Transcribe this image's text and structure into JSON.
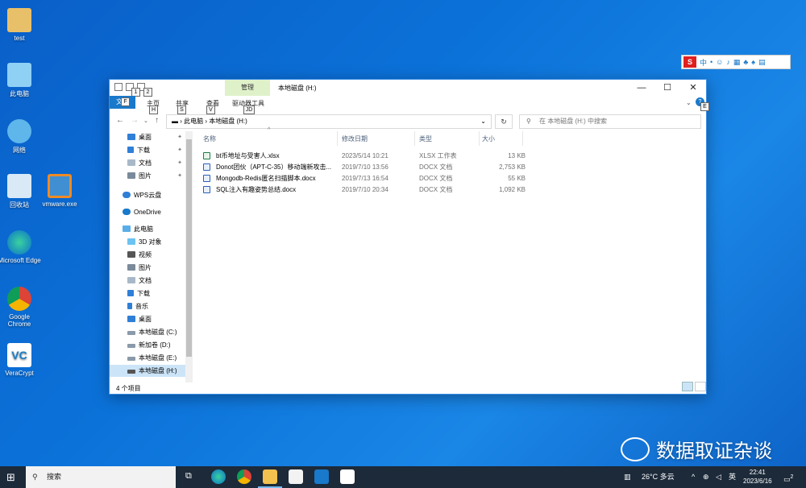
{
  "desktop": {
    "icons": [
      {
        "label": "test"
      },
      {
        "label": "此电脑"
      },
      {
        "label": "网络"
      },
      {
        "label": "回收站"
      },
      {
        "label": "vmware.exe"
      },
      {
        "label": "Microsoft Edge"
      },
      {
        "label": "Google Chrome"
      },
      {
        "label": "VeraCrypt"
      }
    ]
  },
  "window": {
    "title": "本地磁盘 (H:)",
    "manage_tab": "管理",
    "ribbon_tabs": {
      "file": "文件",
      "home": "主页",
      "share": "共享",
      "view": "查看",
      "drive_tools": "驱动器工具"
    },
    "keytips": {
      "file": "F",
      "one": "1",
      "two": "2",
      "home": "H",
      "share": "S",
      "view": "V",
      "drive": "JD",
      "e": "E"
    },
    "buttons": {
      "minimize": "—",
      "maximize": "☐",
      "close": "✕"
    },
    "address": {
      "crumb1": "此电脑",
      "crumb2": "本地磁盘 (H:)"
    },
    "search": {
      "placeholder": "在 本地磁盘 (H:) 中搜索"
    },
    "nav_items": [
      {
        "label": "桌面",
        "pinned": true
      },
      {
        "label": "下载",
        "pinned": true
      },
      {
        "label": "文档",
        "pinned": true
      },
      {
        "label": "图片",
        "pinned": true
      },
      {
        "label": "WPS云盘"
      },
      {
        "label": "OneDrive"
      },
      {
        "label": "此电脑"
      },
      {
        "label": "3D 对象"
      },
      {
        "label": "视频"
      },
      {
        "label": "图片"
      },
      {
        "label": "文档"
      },
      {
        "label": "下载"
      },
      {
        "label": "音乐"
      },
      {
        "label": "桌面"
      },
      {
        "label": "本地磁盘 (C:)"
      },
      {
        "label": "新加卷 (D:)"
      },
      {
        "label": "本地磁盘 (E:)"
      },
      {
        "label": "本地磁盘 (H:)",
        "selected": true
      }
    ],
    "columns": {
      "name": "名称",
      "date": "修改日期",
      "type": "类型",
      "size": "大小"
    },
    "files": [
      {
        "name": "bt币地址与受害人.xlsx",
        "date": "2023/5/14 10:21",
        "type": "XLSX 工作表",
        "size": "13 KB",
        "kind": "xlsx"
      },
      {
        "name": "Donot团伙（APT-C-35）移动端新攻击...",
        "date": "2019/7/10 13:56",
        "type": "DOCX 文档",
        "size": "2,753 KB",
        "kind": "docx"
      },
      {
        "name": "Mongodb-Redis匿名扫描脚本.docx",
        "date": "2019/7/13 16:54",
        "type": "DOCX 文档",
        "size": "55 KB",
        "kind": "docx"
      },
      {
        "name": "SQL注入有趣姿势总结.docx",
        "date": "2019/7/10 20:34",
        "type": "DOCX 文档",
        "size": "1,092 KB",
        "kind": "docx"
      }
    ],
    "status": "4 个项目"
  },
  "ime": {
    "logo": "S",
    "lang": "中"
  },
  "watermark": {
    "text": "数据取证杂谈"
  },
  "taskbar": {
    "search_label": "搜索",
    "weather": "26°C 多云",
    "ime_lang": "英",
    "time": "22:41",
    "date": "2023/6/16",
    "notifications": "2"
  }
}
